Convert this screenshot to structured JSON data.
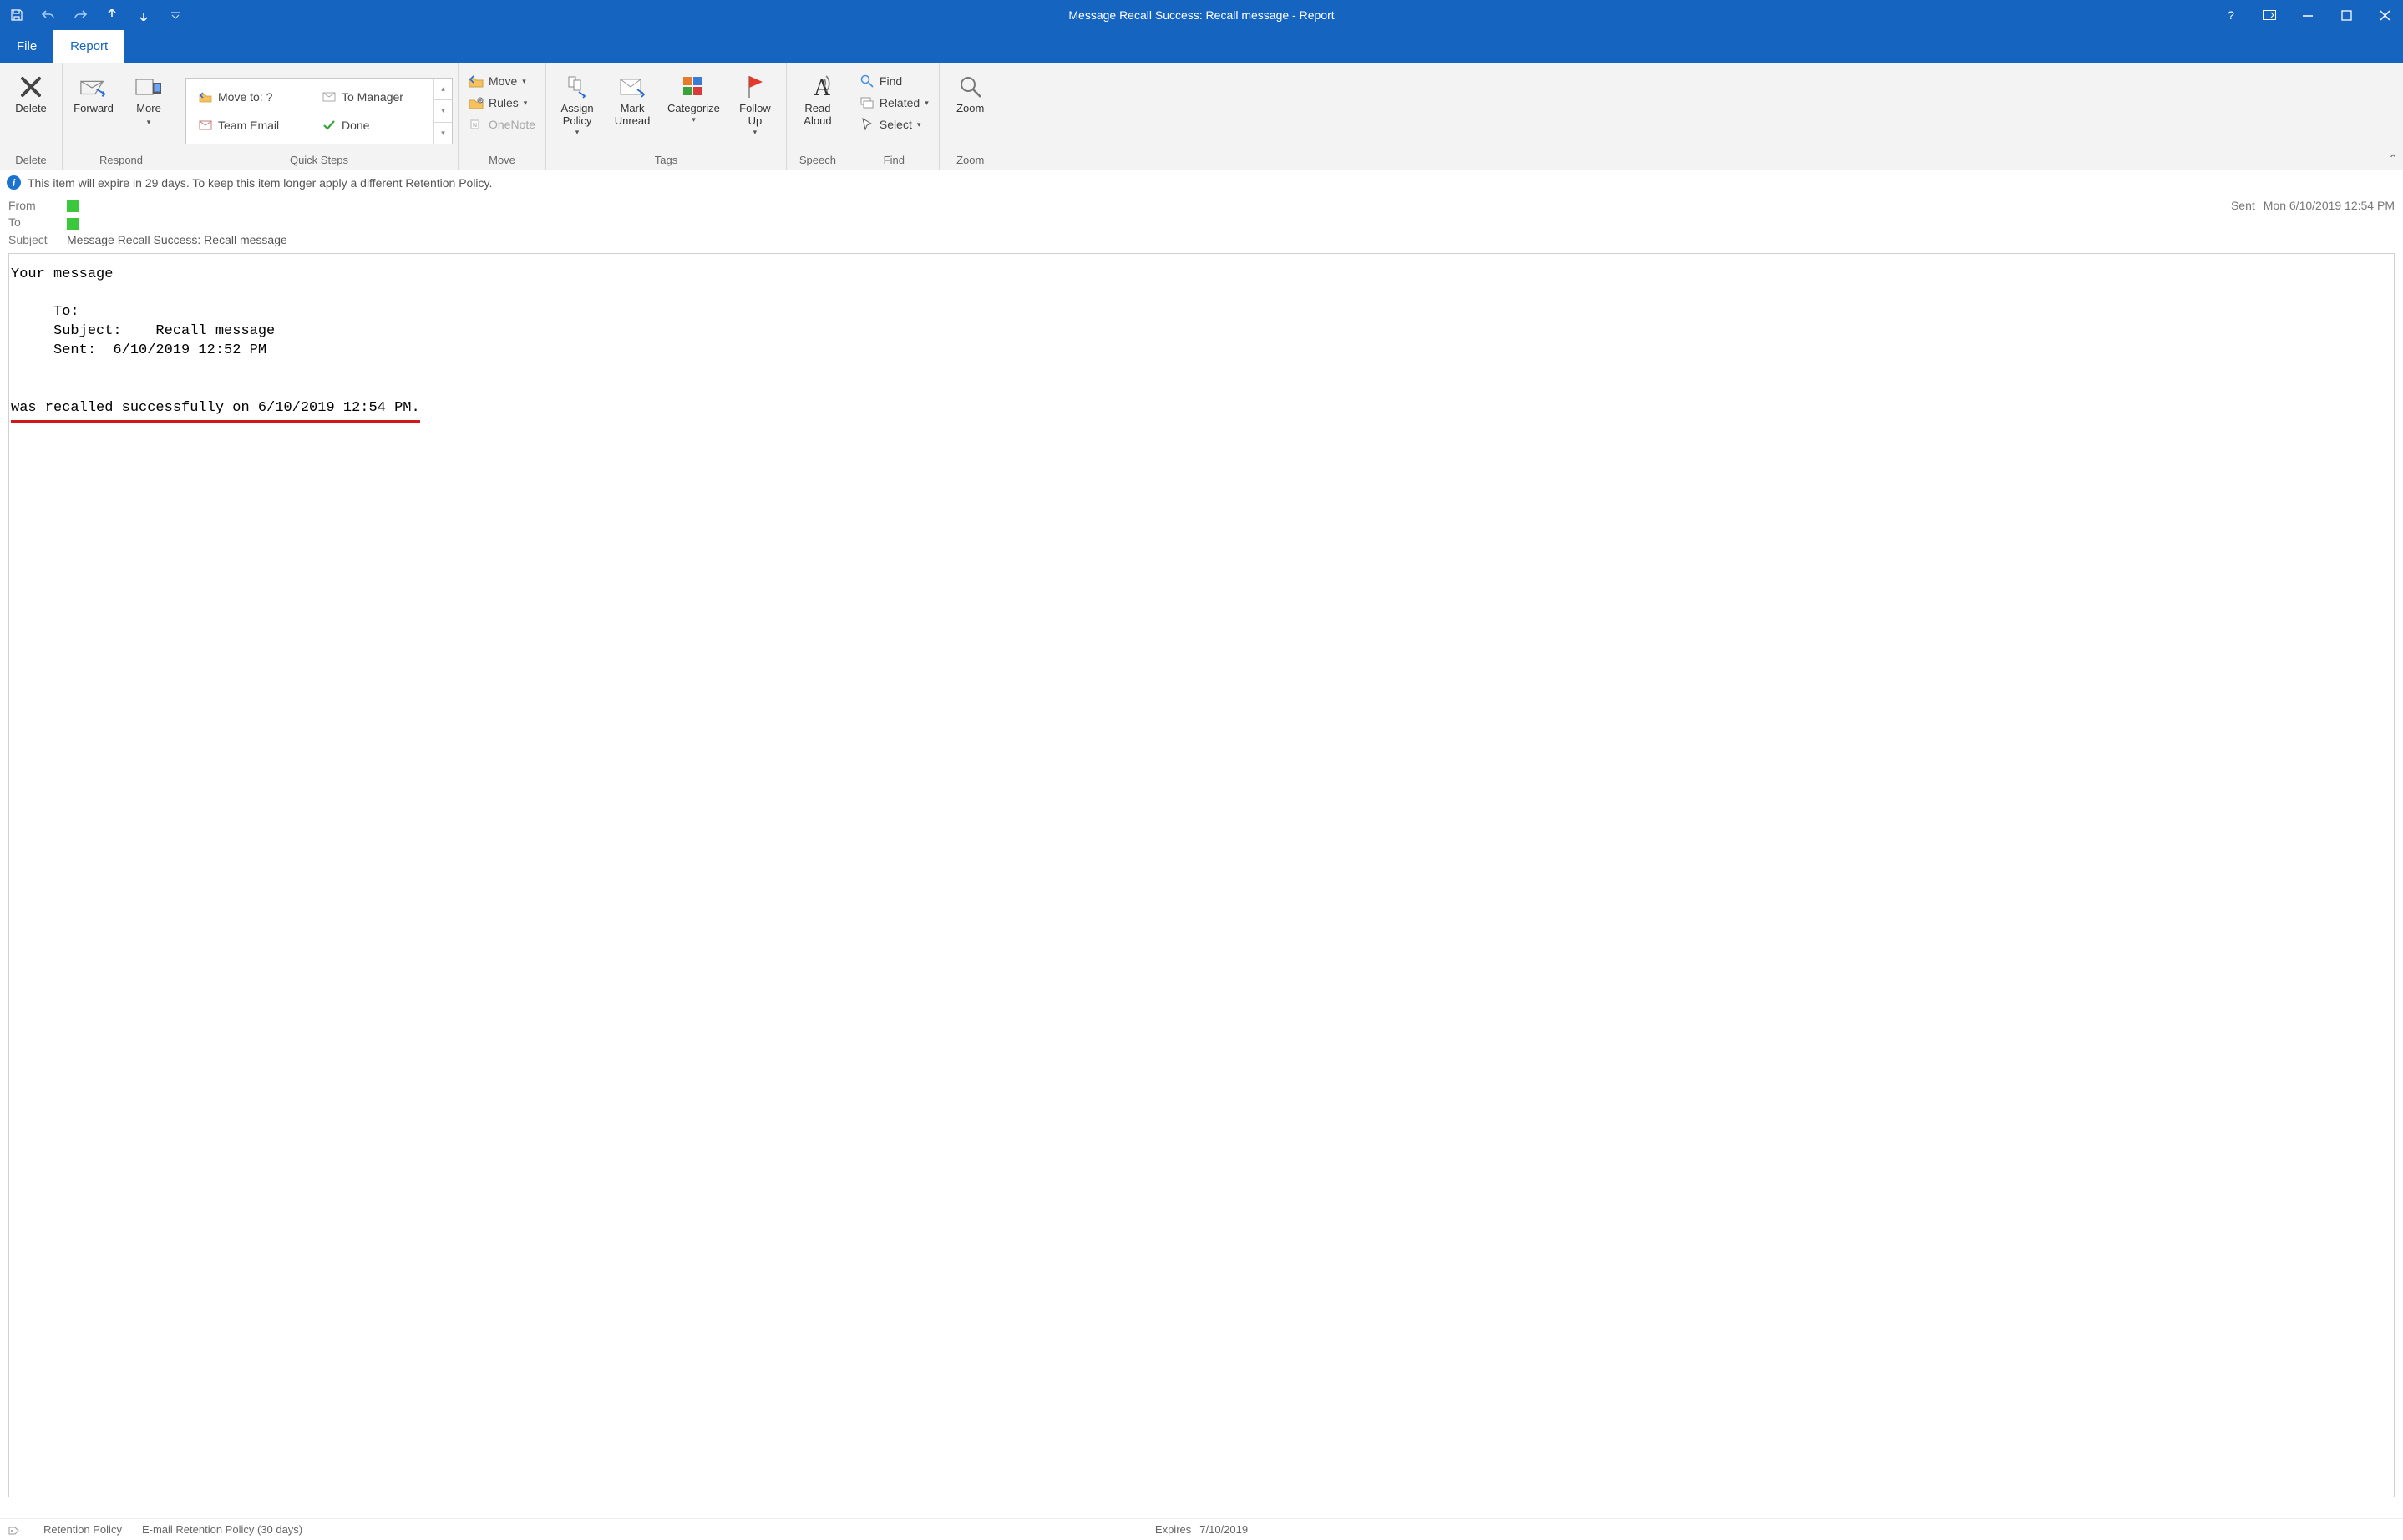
{
  "title": "Message Recall Success: Recall message  -  Report",
  "tabs": {
    "file": "File",
    "report": "Report"
  },
  "ribbon": {
    "delete_group": "Delete",
    "delete_btn": "Delete",
    "respond_group": "Respond",
    "forward_btn": "Forward",
    "more_btn": "More",
    "quicksteps_group": "Quick Steps",
    "qs": {
      "move_to": "Move to: ?",
      "team_email": "Team Email",
      "to_manager": "To Manager",
      "done": "Done"
    },
    "move_group": "Move",
    "move_btn": "Move",
    "rules_btn": "Rules",
    "onenote_btn": "OneNote",
    "tags_group": "Tags",
    "assign_policy": "Assign\nPolicy",
    "mark_unread": "Mark\nUnread",
    "categorize": "Categorize",
    "follow_up": "Follow\nUp",
    "speech_group": "Speech",
    "read_aloud": "Read\nAloud",
    "find_group": "Find",
    "find_btn": "Find",
    "related_btn": "Related",
    "select_btn": "Select",
    "zoom_group": "Zoom",
    "zoom_btn": "Zoom"
  },
  "infobar": "This item will expire in 29 days. To keep this item longer apply a different Retention Policy.",
  "header": {
    "from_label": "From",
    "to_label": "To",
    "subject_label": "Subject",
    "subject_value": "Message Recall Success: Recall message",
    "sent_label": "Sent",
    "sent_value": "Mon 6/10/2019 12:54 PM"
  },
  "body": {
    "l1": "Your message",
    "l2": "     To:",
    "l3": "     Subject:    Recall message",
    "l4": "     Sent:  6/10/2019 12:52 PM",
    "l5": "was recalled successfully on 6/10/2019 12:54 PM."
  },
  "status": {
    "retention_label": "Retention Policy",
    "retention_value": "E-mail Retention Policy (30 days)",
    "expires_label": "Expires",
    "expires_value": "7/10/2019"
  }
}
